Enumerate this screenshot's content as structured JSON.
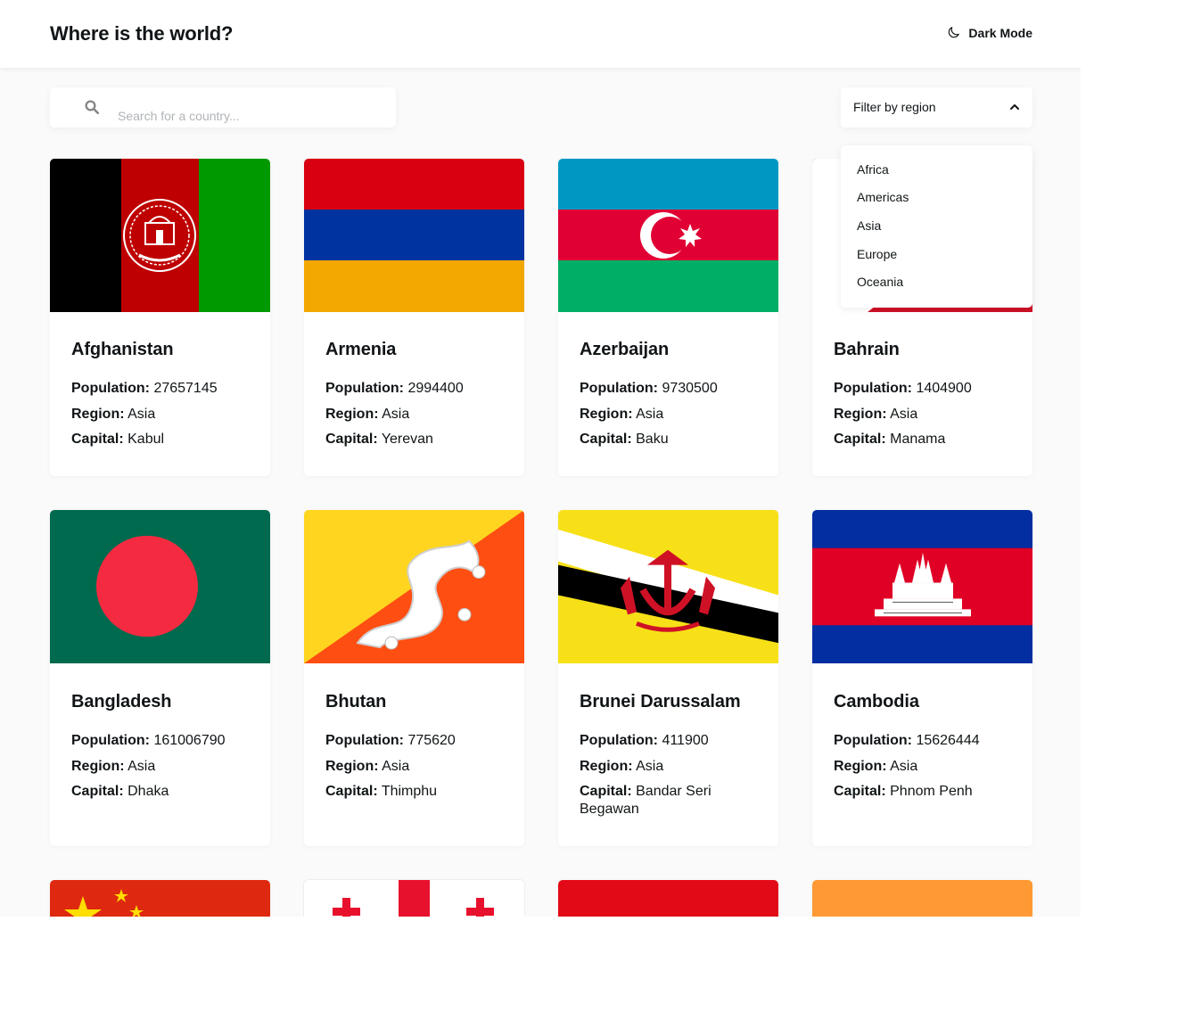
{
  "header": {
    "title": "Where is the world?",
    "theme_label": "Dark Mode"
  },
  "search": {
    "placeholder": "Search for a country..."
  },
  "filter": {
    "label": "Filter by region",
    "options": [
      "Africa",
      "Americas",
      "Asia",
      "Europe",
      "Oceania"
    ]
  },
  "labels": {
    "population": "Population:",
    "region": "Region:",
    "capital": "Capital:"
  },
  "countries": [
    {
      "name": "Afghanistan",
      "population": "27657145",
      "region": "Asia",
      "capital": "Kabul"
    },
    {
      "name": "Armenia",
      "population": "2994400",
      "region": "Asia",
      "capital": "Yerevan"
    },
    {
      "name": "Azerbaijan",
      "population": "9730500",
      "region": "Asia",
      "capital": "Baku"
    },
    {
      "name": "Bahrain",
      "population": "1404900",
      "region": "Asia",
      "capital": "Manama"
    },
    {
      "name": "Bangladesh",
      "population": "161006790",
      "region": "Asia",
      "capital": "Dhaka"
    },
    {
      "name": "Bhutan",
      "population": "775620",
      "region": "Asia",
      "capital": "Thimphu"
    },
    {
      "name": "Brunei Darussalam",
      "population": "411900",
      "region": "Asia",
      "capital": "Bandar Seri Begawan"
    },
    {
      "name": "Cambodia",
      "population": "15626444",
      "region": "Asia",
      "capital": "Phnom Penh"
    }
  ],
  "colors": {
    "background": "#fafafa",
    "card": "#ffffff",
    "text": "#111517",
    "placeholder": "#b0b3b6"
  }
}
